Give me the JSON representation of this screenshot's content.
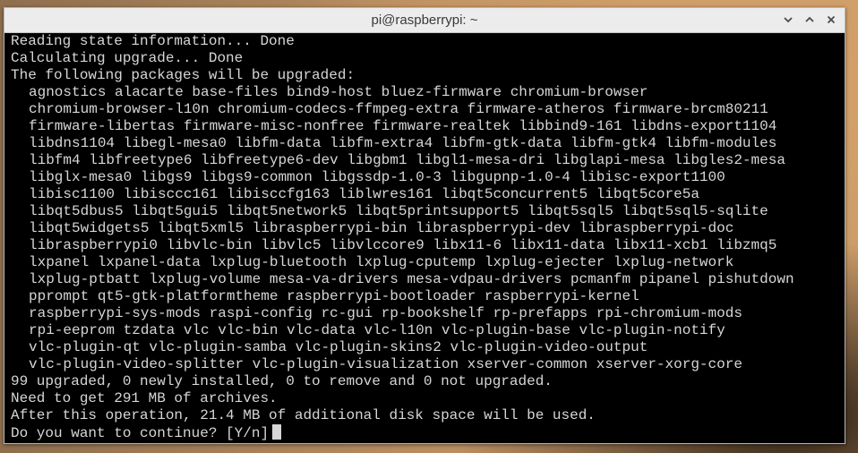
{
  "window": {
    "title": "pi@raspberrypi: ~",
    "controls": [
      {
        "name": "minimize",
        "icon": "chevron-down-icon"
      },
      {
        "name": "maximize",
        "icon": "chevron-up-icon"
      },
      {
        "name": "close",
        "icon": "close-icon"
      }
    ]
  },
  "terminal": {
    "header_lines": [
      "Reading state information... Done",
      "Calculating upgrade... Done",
      "The following packages will be upgraded:"
    ],
    "package_lines": [
      "agnostics alacarte base-files bind9-host bluez-firmware chromium-browser",
      "chromium-browser-l10n chromium-codecs-ffmpeg-extra firmware-atheros firmware-brcm80211",
      "firmware-libertas firmware-misc-nonfree firmware-realtek libbind9-161 libdns-export1104",
      "libdns1104 libegl-mesa0 libfm-data libfm-extra4 libfm-gtk-data libfm-gtk4 libfm-modules",
      "libfm4 libfreetype6 libfreetype6-dev libgbm1 libgl1-mesa-dri libglapi-mesa libgles2-mesa",
      "libglx-mesa0 libgs9 libgs9-common libgssdp-1.0-3 libgupnp-1.0-4 libisc-export1100",
      "libisc1100 libisccc161 libisccfg163 liblwres161 libqt5concurrent5 libqt5core5a",
      "libqt5dbus5 libqt5gui5 libqt5network5 libqt5printsupport5 libqt5sql5 libqt5sql5-sqlite",
      "libqt5widgets5 libqt5xml5 libraspberrypi-bin libraspberrypi-dev libraspberrypi-doc",
      "libraspberrypi0 libvlc-bin libvlc5 libvlccore9 libx11-6 libx11-data libx11-xcb1 libzmq5",
      "lxpanel lxpanel-data lxplug-bluetooth lxplug-cputemp lxplug-ejecter lxplug-network",
      "lxplug-ptbatt lxplug-volume mesa-va-drivers mesa-vdpau-drivers pcmanfm pipanel pishutdown",
      "pprompt qt5-gtk-platformtheme raspberrypi-bootloader raspberrypi-kernel",
      "raspberrypi-sys-mods raspi-config rc-gui rp-bookshelf rp-prefapps rpi-chromium-mods",
      "rpi-eeprom tzdata vlc vlc-bin vlc-data vlc-l10n vlc-plugin-base vlc-plugin-notify",
      "vlc-plugin-qt vlc-plugin-samba vlc-plugin-skins2 vlc-plugin-video-output",
      "vlc-plugin-video-splitter vlc-plugin-visualization xserver-common xserver-xorg-core"
    ],
    "summary_lines": [
      "99 upgraded, 0 newly installed, 0 to remove and 0 not upgraded.",
      "Need to get 291 MB of archives.",
      "After this operation, 21.4 MB of additional disk space will be used."
    ],
    "prompt": "Do you want to continue? [Y/n]"
  }
}
